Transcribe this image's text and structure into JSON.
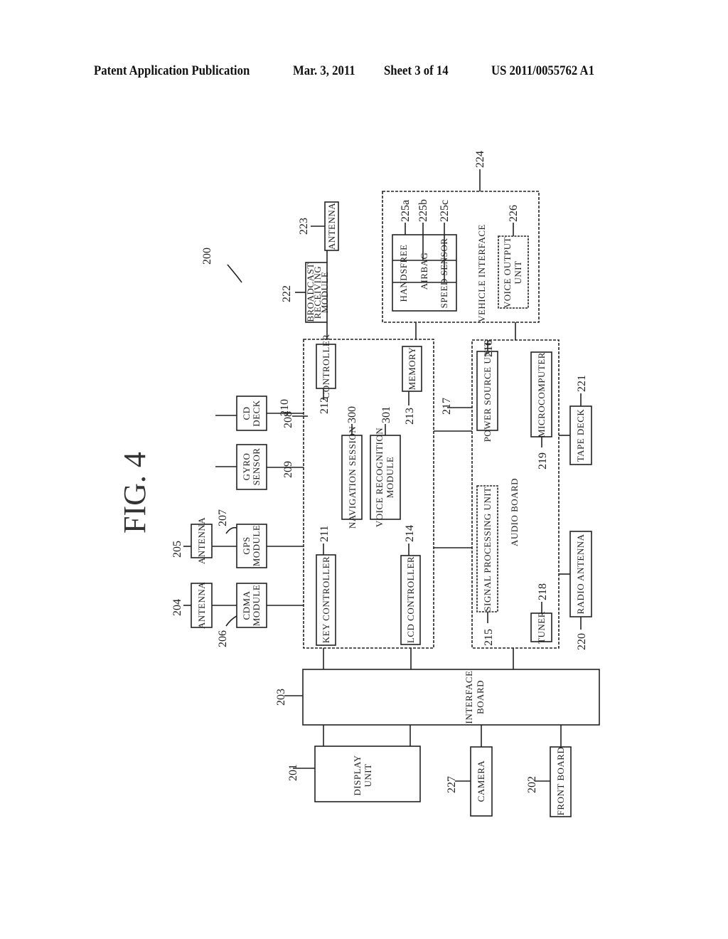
{
  "header": {
    "left": "Patent Application Publication",
    "date": "Mar. 3, 2011",
    "sheet": "Sheet 3 of 14",
    "pub_number": "US 2011/0055762 A1"
  },
  "figure": {
    "title": "FIG. 4",
    "system_ref": "200"
  },
  "blocks": {
    "antenna_223": {
      "ref": "223",
      "label": "ANTENNA"
    },
    "broadcast_222": {
      "ref": "222",
      "label1": "BROADCAST",
      "label2": "RECEIVING",
      "label3": "MODULE"
    },
    "vehicle_interface": {
      "ref": "224",
      "label": "VEHICLE INTERFACE"
    },
    "handsfree": {
      "ref": "225a",
      "label": "HANDSFREE"
    },
    "airbag": {
      "ref": "225b",
      "label": "AIRBAG"
    },
    "speed_sensor": {
      "ref": "225c",
      "label": "SPEED SENSOR"
    },
    "voice_output": {
      "ref": "226",
      "label1": "VOICE OUTPUT",
      "label2": "UNIT"
    },
    "main_board": {
      "ref": "210"
    },
    "controller": {
      "ref": "212",
      "label": "CONTROLLER"
    },
    "memory": {
      "ref": "213",
      "label": "MEMORY"
    },
    "navigation_session": {
      "ref": "300",
      "label": "NAVIGATION SESSION"
    },
    "voice_recognition": {
      "ref": "301",
      "label1": "VOICE RECOGNITION",
      "label2": "MODULE"
    },
    "key_controller": {
      "ref": "211",
      "label": "KEY CONTROLLER"
    },
    "lcd_controller": {
      "ref": "214",
      "label": "LCD CONTROLLER"
    },
    "cd_deck": {
      "ref": "208",
      "label1": "CD",
      "label2": "DECK"
    },
    "gyro_sensor": {
      "ref": "209",
      "label1": "GYRO",
      "label2": "SENSOR"
    },
    "antenna_205": {
      "ref": "205",
      "label": "ANTENNA"
    },
    "gps_module": {
      "ref": "207",
      "label1": "GPS",
      "label2": "MODULE"
    },
    "antenna_204": {
      "ref": "204",
      "label": "ANTENNA"
    },
    "cdma_module": {
      "ref": "206",
      "label1": "CDMA",
      "label2": "MODULE"
    },
    "audio_board": {
      "ref": "217",
      "label": "AUDIO BOARD"
    },
    "power_source": {
      "ref": "216",
      "label": "POWER SOURCE UNIT"
    },
    "microcomputer": {
      "ref": "219",
      "label": "MICROCOMPUTER"
    },
    "signal_processing": {
      "ref": "215",
      "label": "SIGNAL PROCESSING UNIT"
    },
    "tuner": {
      "ref": "218",
      "label": "TUNER"
    },
    "tape_deck": {
      "ref": "221",
      "label": "TAPE DECK"
    },
    "radio_antenna": {
      "ref": "220",
      "label": "RADIO ANTENNA"
    },
    "interface_board": {
      "ref": "203",
      "label1": "INTERFACE",
      "label2": "BOARD"
    },
    "display_unit": {
      "ref": "201",
      "label1": "DISPLAY",
      "label2": "UNIT"
    },
    "camera": {
      "ref": "227",
      "label": "CAMERA"
    },
    "front_board": {
      "ref": "202",
      "label": "FRONT BOARD"
    }
  }
}
